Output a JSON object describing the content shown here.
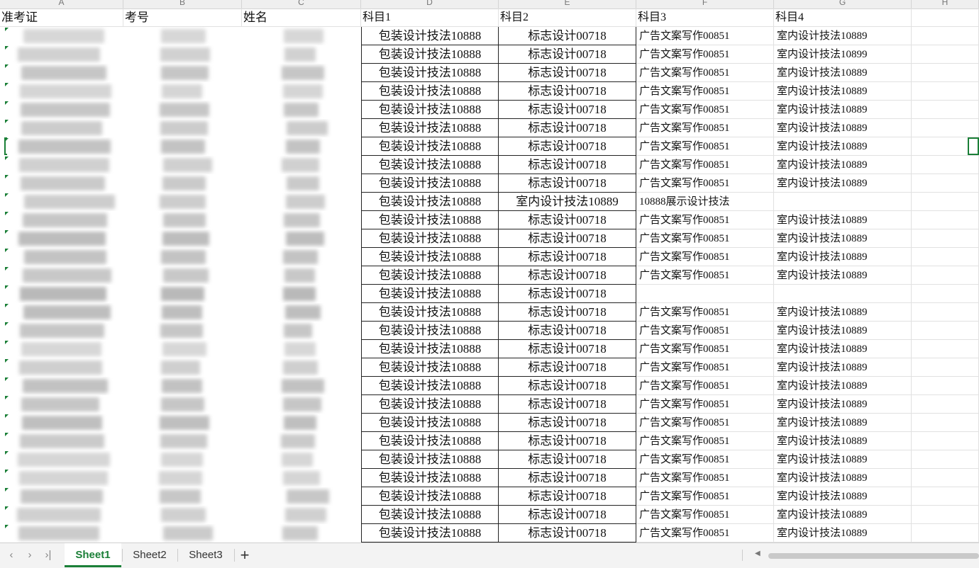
{
  "column_letters": [
    "A",
    "B",
    "C",
    "D",
    "E",
    "F",
    "G",
    "H"
  ],
  "headers": [
    "准考证",
    "考号",
    "姓名",
    "科目1",
    "科目2",
    "科目3",
    "科目4",
    ""
  ],
  "rows": [
    [
      "包装设计技法10888",
      "标志设计00718",
      "广告文案写作00851",
      "室内设计技法10889"
    ],
    [
      "包装设计技法10888",
      "标志设计00718",
      "广告文案写作00851",
      "室内设计技法10899"
    ],
    [
      "包装设计技法10888",
      "标志设计00718",
      "广告文案写作00851",
      "室内设计技法10889"
    ],
    [
      "包装设计技法10888",
      "标志设计00718",
      "广告文案写作00851",
      "室内设计技法10889"
    ],
    [
      "包装设计技法10888",
      "标志设计00718",
      "广告文案写作00851",
      "室内设计技法10889"
    ],
    [
      "包装设计技法10888",
      "标志设计00718",
      "广告文案写作00851",
      "室内设计技法10889"
    ],
    [
      "包装设计技法10888",
      "标志设计00718",
      "广告文案写作00851",
      "室内设计技法10889"
    ],
    [
      "包装设计技法10888",
      "标志设计00718",
      "广告文案写作00851",
      "室内设计技法10889"
    ],
    [
      "包装设计技法10888",
      "标志设计00718",
      "广告文案写作00851",
      "室内设计技法10889"
    ],
    [
      "包装设计技法10888",
      "室内设计技法10889",
      "10888展示设计技法",
      ""
    ],
    [
      "包装设计技法10888",
      "标志设计00718",
      "广告文案写作00851",
      "室内设计技法10889"
    ],
    [
      "包装设计技法10888",
      "标志设计00718",
      "广告文案写作00851",
      "室内设计技法10889"
    ],
    [
      "包装设计技法10888",
      "标志设计00718",
      "广告文案写作00851",
      "室内设计技法10889"
    ],
    [
      "包装设计技法10888",
      "标志设计00718",
      "广告文案写作00851",
      "室内设计技法10889"
    ],
    [
      "包装设计技法10888",
      "标志设计00718",
      "",
      ""
    ],
    [
      "包装设计技法10888",
      "标志设计00718",
      "广告文案写作00851",
      "室内设计技法10889"
    ],
    [
      "包装设计技法10888",
      "标志设计00718",
      "广告文案写作00851",
      "室内设计技法10889"
    ],
    [
      "包装设计技法10888",
      "标志设计00718",
      "广告文案写作00851",
      "室内设计技法10889"
    ],
    [
      "包装设计技法10888",
      "标志设计00718",
      "广告文案写作00851",
      "室内设计技法10889"
    ],
    [
      "包装设计技法10888",
      "标志设计00718",
      "广告文案写作00851",
      "室内设计技法10889"
    ],
    [
      "包装设计技法10888",
      "标志设计00718",
      "广告文案写作00851",
      "室内设计技法10889"
    ],
    [
      "包装设计技法10888",
      "标志设计00718",
      "广告文案写作00851",
      "室内设计技法10889"
    ],
    [
      "包装设计技法10888",
      "标志设计00718",
      "广告文案写作00851",
      "室内设计技法10889"
    ],
    [
      "包装设计技法10888",
      "标志设计00718",
      "广告文案写作00851",
      "室内设计技法10889"
    ],
    [
      "包装设计技法10888",
      "标志设计00718",
      "广告文案写作00851",
      "室内设计技法10889"
    ],
    [
      "包装设计技法10888",
      "标志设计00718",
      "广告文案写作00851",
      "室内设计技法10889"
    ],
    [
      "包装设计技法10888",
      "标志设计00718",
      "广告文案写作00851",
      "室内设计技法10889"
    ],
    [
      "包装设计技法10888",
      "标志设计00718",
      "广告文案写作00851",
      "室内设计技法10889"
    ]
  ],
  "sheet_tabs": [
    "Sheet1",
    "Sheet2",
    "Sheet3"
  ],
  "active_tab": "Sheet1",
  "icons": {
    "first_sheet": "‹",
    "prev_sheet": "›",
    "last_sheet": "›|",
    "add_sheet": "+",
    "scroll_left": "◀"
  },
  "colors": {
    "accent": "#1a7f37",
    "gridline": "#e1e1e1",
    "header_bg": "#efefef"
  }
}
